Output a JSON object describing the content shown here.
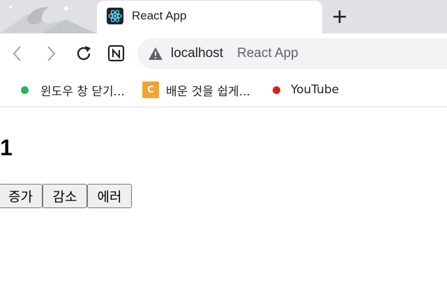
{
  "browser": {
    "tab": {
      "title": "React App",
      "favicon": "react-logo-icon"
    },
    "new_tab_icon": "plus-icon",
    "toolbar": {
      "back_icon": "back-arrow-icon",
      "forward_icon": "forward-arrow-icon",
      "reload_icon": "reload-icon",
      "notion_icon": "notion-icon",
      "url_host": "localhost",
      "url_page_title": "React App",
      "security_icon": "warning-triangle-icon"
    },
    "bookmarks": [
      {
        "label": "윈도우 창 닫기...",
        "icon": "green-dot-icon",
        "color": "#1db954"
      },
      {
        "label": "배운 것을 쉽게...",
        "icon": "c-logo-icon",
        "color": "#f4a236",
        "icon_text": "C"
      },
      {
        "label": "YouTube",
        "icon": "red-dot-icon",
        "color": "#e21c1c"
      }
    ]
  },
  "page": {
    "count": "1",
    "buttons": {
      "increase": "증가",
      "decrease": "감소",
      "error": "에러"
    }
  }
}
